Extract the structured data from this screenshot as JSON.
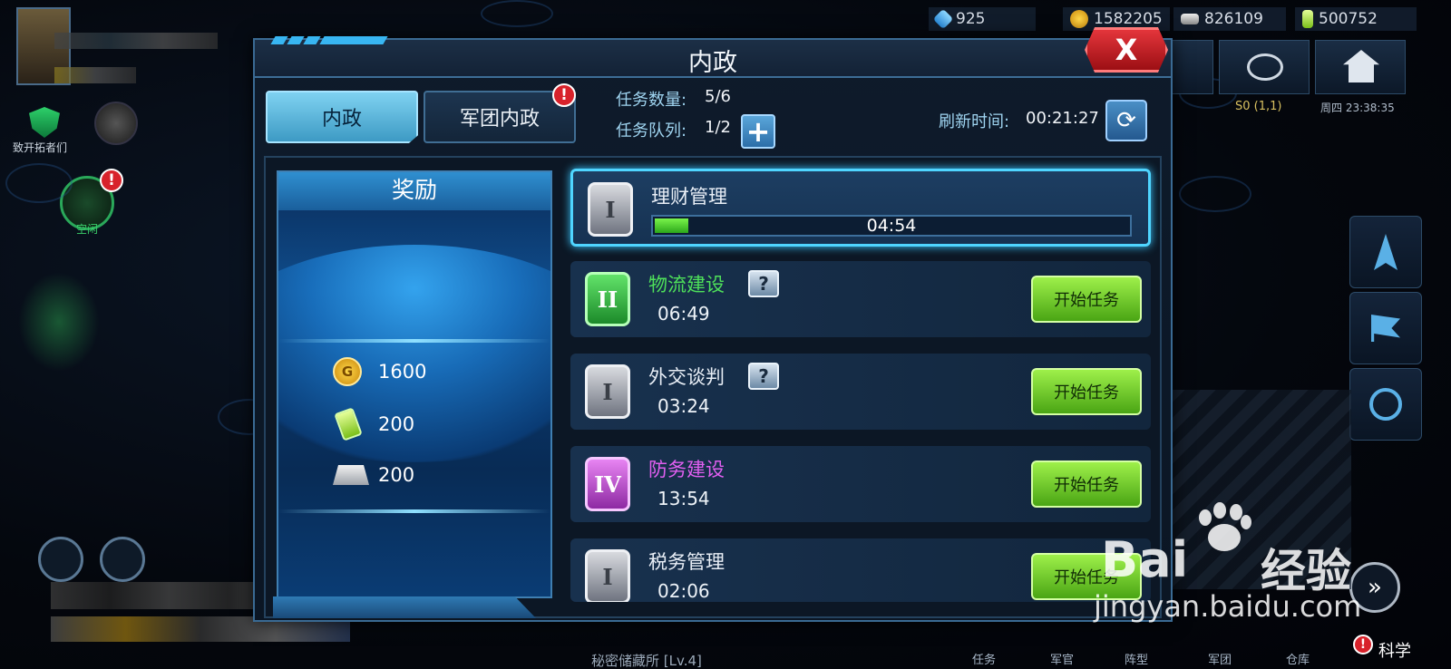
{
  "resources": {
    "crystal": "925",
    "gold": "1582205",
    "metal": "826109",
    "energy": "500752"
  },
  "background": {
    "left_item_1": "致开拓者们",
    "left_item_2": "空闲",
    "coordinates": "S0 (1,1)",
    "clock": "周四 23:38:35",
    "bottom_tabs": [
      "任务",
      "军官",
      "阵型",
      "军团",
      "仓库",
      "科学"
    ],
    "building_label": "秘密储藏所 [Lv.4]"
  },
  "dialog": {
    "title": "内政",
    "close_label": "X",
    "tabs": [
      {
        "label": "内政",
        "active": true
      },
      {
        "label": "军团内政",
        "active": false,
        "alert": "!"
      }
    ],
    "mission_count_label": "任务数量:",
    "mission_count_value": "5/6",
    "mission_queue_label": "任务队列:",
    "mission_queue_value": "1/2",
    "refresh_label": "刷新时间:",
    "refresh_value": "00:21:27"
  },
  "reward": {
    "title": "奖励",
    "items": [
      {
        "icon": "gold-coin-icon",
        "amount": "1600"
      },
      {
        "icon": "energy-battery-icon",
        "amount": "200"
      },
      {
        "icon": "metal-ingot-icon",
        "amount": "200"
      }
    ]
  },
  "missions": [
    {
      "rank": "I",
      "rank_color": "gray",
      "name": "理财管理",
      "name_color": "#e8eef6",
      "time": "04:54",
      "in_progress": true,
      "progress": 0.07
    },
    {
      "rank": "II",
      "rank_color": "green",
      "name": "物流建设",
      "name_color": "#4ee05a",
      "time": "06:49",
      "mystery": "?",
      "button": "开始任务"
    },
    {
      "rank": "I",
      "rank_color": "gray",
      "name": "外交谈判",
      "name_color": "#e8eef6",
      "time": "03:24",
      "mystery": "?",
      "button": "开始任务"
    },
    {
      "rank": "IV",
      "rank_color": "purple",
      "name": "防务建设",
      "name_color": "#e05ff0",
      "time": "13:54",
      "button": "开始任务"
    },
    {
      "rank": "I",
      "rank_color": "gray",
      "name": "税务管理",
      "name_color": "#e8eef6",
      "time": "02:06",
      "button": "开始任务"
    }
  ],
  "watermark": {
    "brand": "Bai",
    "brand_suffix": "经验",
    "url": "jingyan.baidu.com"
  },
  "colors": {
    "accent": "#4fd5ff",
    "start_button": "#7ad93a",
    "close_button": "#d8222b"
  }
}
